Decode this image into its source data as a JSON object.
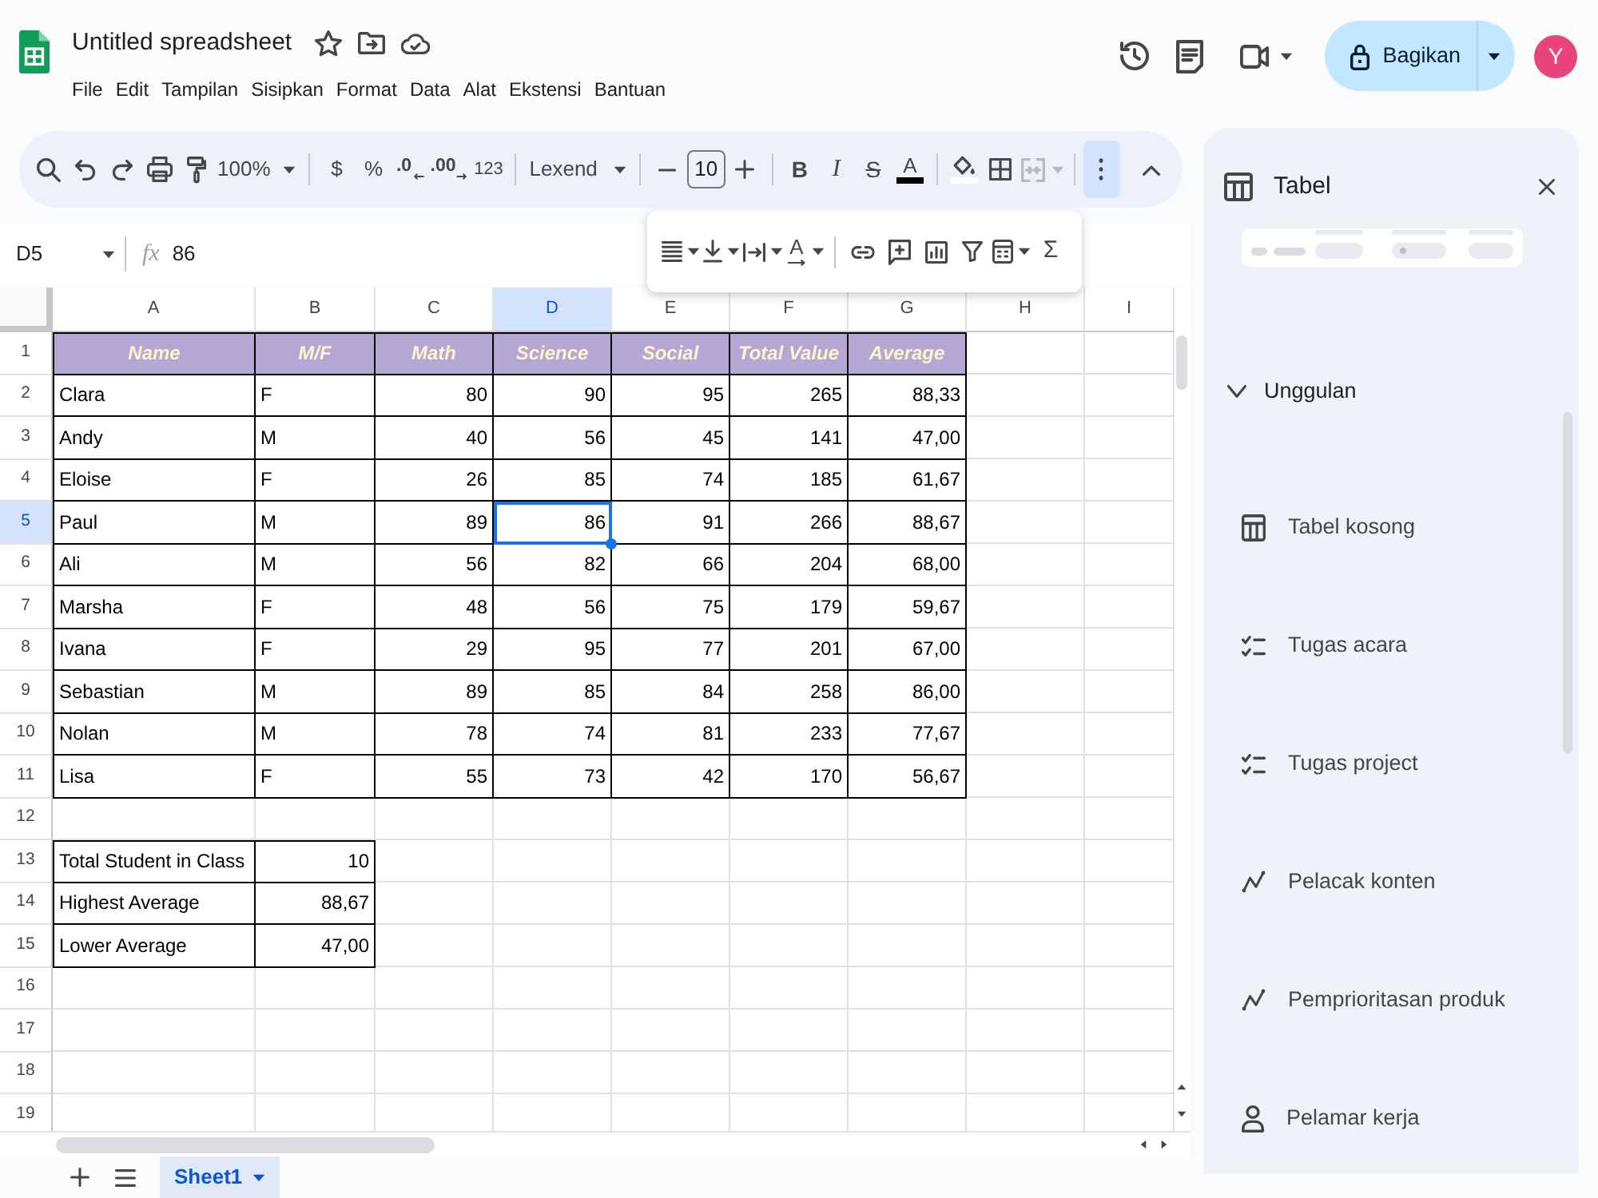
{
  "app": {
    "title": "Untitled spreadsheet",
    "menu": [
      "File",
      "Edit",
      "Tampilan",
      "Sisipkan",
      "Format",
      "Data",
      "Alat",
      "Ekstensi",
      "Bantuan"
    ],
    "share_button": "Bagikan",
    "avatar": "Y"
  },
  "toolbar": {
    "zoom": "100%",
    "currency": "$",
    "percent": "%",
    "decrease_decimal": ".0",
    "increase_decimal": ".00",
    "number_format": "123",
    "font": "Lexend",
    "font_size": "10",
    "bold": "B",
    "italic": "I",
    "strikethrough": "S",
    "text_color": "A",
    "merge_cells": {
      "disabled": true
    },
    "more_options": {
      "expanded": true
    }
  },
  "more_toolbar": {
    "text_rotation": "A",
    "functions": "Σ"
  },
  "formula_bar": {
    "name_box": "D5",
    "function_label": "fx",
    "formula": "86"
  },
  "sheet": {
    "columns": [
      {
        "label": "A",
        "selected": false
      },
      {
        "label": "B",
        "selected": false
      },
      {
        "label": "C",
        "selected": false
      },
      {
        "label": "D",
        "selected": true
      },
      {
        "label": "E",
        "selected": false
      },
      {
        "label": "F",
        "selected": false
      },
      {
        "label": "G",
        "selected": false
      },
      {
        "label": "H",
        "selected": false
      },
      {
        "label": "I",
        "selected": false
      }
    ],
    "rows": [
      {
        "label": "1",
        "selected": false,
        "kind": "header",
        "cells": [
          {
            "text": "Name",
            "kind": "text"
          },
          {
            "text": "M/F",
            "kind": "text"
          },
          {
            "text": "Math",
            "kind": "text"
          },
          {
            "text": "Science",
            "kind": "text"
          },
          {
            "text": "Social",
            "kind": "text"
          },
          {
            "text": "Total Value",
            "kind": "text"
          },
          {
            "text": "Average",
            "kind": "text"
          }
        ]
      },
      {
        "label": "2",
        "selected": false,
        "kind": "data",
        "cells": [
          {
            "text": "Clara",
            "kind": "text"
          },
          {
            "text": "F",
            "kind": "text"
          },
          {
            "text": "80",
            "kind": "number"
          },
          {
            "text": "90",
            "kind": "number"
          },
          {
            "text": "95",
            "kind": "number"
          },
          {
            "text": "265",
            "kind": "number"
          },
          {
            "text": "88,33",
            "kind": "number"
          }
        ]
      },
      {
        "label": "3",
        "selected": false,
        "kind": "data",
        "cells": [
          {
            "text": "Andy",
            "kind": "text"
          },
          {
            "text": "M",
            "kind": "text"
          },
          {
            "text": "40",
            "kind": "number"
          },
          {
            "text": "56",
            "kind": "number"
          },
          {
            "text": "45",
            "kind": "number"
          },
          {
            "text": "141",
            "kind": "number"
          },
          {
            "text": "47,00",
            "kind": "number"
          }
        ]
      },
      {
        "label": "4",
        "selected": false,
        "kind": "data",
        "cells": [
          {
            "text": "Eloise",
            "kind": "text"
          },
          {
            "text": "F",
            "kind": "text"
          },
          {
            "text": "26",
            "kind": "number"
          },
          {
            "text": "85",
            "kind": "number"
          },
          {
            "text": "74",
            "kind": "number"
          },
          {
            "text": "185",
            "kind": "number"
          },
          {
            "text": "61,67",
            "kind": "number"
          }
        ]
      },
      {
        "label": "5",
        "selected": true,
        "kind": "data",
        "cells": [
          {
            "text": "Paul",
            "kind": "text"
          },
          {
            "text": "M",
            "kind": "text"
          },
          {
            "text": "89",
            "kind": "number"
          },
          {
            "text": "86",
            "kind": "number"
          },
          {
            "text": "91",
            "kind": "number"
          },
          {
            "text": "266",
            "kind": "number"
          },
          {
            "text": "88,67",
            "kind": "number"
          }
        ]
      },
      {
        "label": "6",
        "selected": false,
        "kind": "data",
        "cells": [
          {
            "text": "Ali",
            "kind": "text"
          },
          {
            "text": "M",
            "kind": "text"
          },
          {
            "text": "56",
            "kind": "number"
          },
          {
            "text": "82",
            "kind": "number"
          },
          {
            "text": "66",
            "kind": "number"
          },
          {
            "text": "204",
            "kind": "number"
          },
          {
            "text": "68,00",
            "kind": "number"
          }
        ]
      },
      {
        "label": "7",
        "selected": false,
        "kind": "data",
        "cells": [
          {
            "text": "Marsha",
            "kind": "text"
          },
          {
            "text": "F",
            "kind": "text"
          },
          {
            "text": "48",
            "kind": "number"
          },
          {
            "text": "56",
            "kind": "number"
          },
          {
            "text": "75",
            "kind": "number"
          },
          {
            "text": "179",
            "kind": "number"
          },
          {
            "text": "59,67",
            "kind": "number"
          }
        ]
      },
      {
        "label": "8",
        "selected": false,
        "kind": "data",
        "cells": [
          {
            "text": "Ivana",
            "kind": "text"
          },
          {
            "text": "F",
            "kind": "text"
          },
          {
            "text": "29",
            "kind": "number"
          },
          {
            "text": "95",
            "kind": "number"
          },
          {
            "text": "77",
            "kind": "number"
          },
          {
            "text": "201",
            "kind": "number"
          },
          {
            "text": "67,00",
            "kind": "number"
          }
        ]
      },
      {
        "label": "9",
        "selected": false,
        "kind": "data",
        "cells": [
          {
            "text": "Sebastian",
            "kind": "text"
          },
          {
            "text": "M",
            "kind": "text"
          },
          {
            "text": "89",
            "kind": "number"
          },
          {
            "text": "85",
            "kind": "number"
          },
          {
            "text": "84",
            "kind": "number"
          },
          {
            "text": "258",
            "kind": "number"
          },
          {
            "text": "86,00",
            "kind": "number"
          }
        ]
      },
      {
        "label": "10",
        "selected": false,
        "kind": "data",
        "cells": [
          {
            "text": "Nolan",
            "kind": "text"
          },
          {
            "text": "M",
            "kind": "text"
          },
          {
            "text": "78",
            "kind": "number"
          },
          {
            "text": "74",
            "kind": "number"
          },
          {
            "text": "81",
            "kind": "number"
          },
          {
            "text": "233",
            "kind": "number"
          },
          {
            "text": "77,67",
            "kind": "number"
          }
        ]
      },
      {
        "label": "11",
        "selected": false,
        "kind": "data",
        "cells": [
          {
            "text": "Lisa",
            "kind": "text"
          },
          {
            "text": "F",
            "kind": "text"
          },
          {
            "text": "55",
            "kind": "number"
          },
          {
            "text": "73",
            "kind": "number"
          },
          {
            "text": "42",
            "kind": "number"
          },
          {
            "text": "170",
            "kind": "number"
          },
          {
            "text": "56,67",
            "kind": "number"
          }
        ]
      },
      {
        "label": "12",
        "selected": false
      },
      {
        "label": "13",
        "selected": false,
        "kind": "data",
        "cells": [
          {
            "text": "Total Student in Class",
            "kind": "text"
          },
          {
            "text": "10",
            "kind": "number"
          }
        ]
      },
      {
        "label": "14",
        "selected": false,
        "kind": "data",
        "cells": [
          {
            "text": "Highest Average",
            "kind": "text"
          },
          {
            "text": "88,67",
            "kind": "number"
          }
        ]
      },
      {
        "label": "15",
        "selected": false,
        "kind": "data",
        "cells": [
          {
            "text": "Lower Average",
            "kind": "text"
          },
          {
            "text": "47,00",
            "kind": "number"
          }
        ]
      },
      {
        "label": "16",
        "selected": false
      },
      {
        "label": "17",
        "selected": false
      },
      {
        "label": "18",
        "selected": false
      },
      {
        "label": "19",
        "selected": false
      }
    ]
  },
  "sheet_tabs": [
    {
      "label": "Sheet1",
      "selected": true
    }
  ],
  "side_panel": {
    "title": "Tabel",
    "section": {
      "label": "Unggulan",
      "expanded": true
    },
    "templates": [
      {
        "label": "Tabel kosong",
        "kind": "table"
      },
      {
        "label": "Tugas acara",
        "kind": "checklist"
      },
      {
        "label": "Tugas project",
        "kind": "checklist"
      },
      {
        "label": "Pelacak konten",
        "kind": "trend"
      },
      {
        "label": "Pemprioritasan produk",
        "kind": "trend"
      },
      {
        "label": "Pelamar kerja",
        "kind": "person"
      }
    ]
  }
}
